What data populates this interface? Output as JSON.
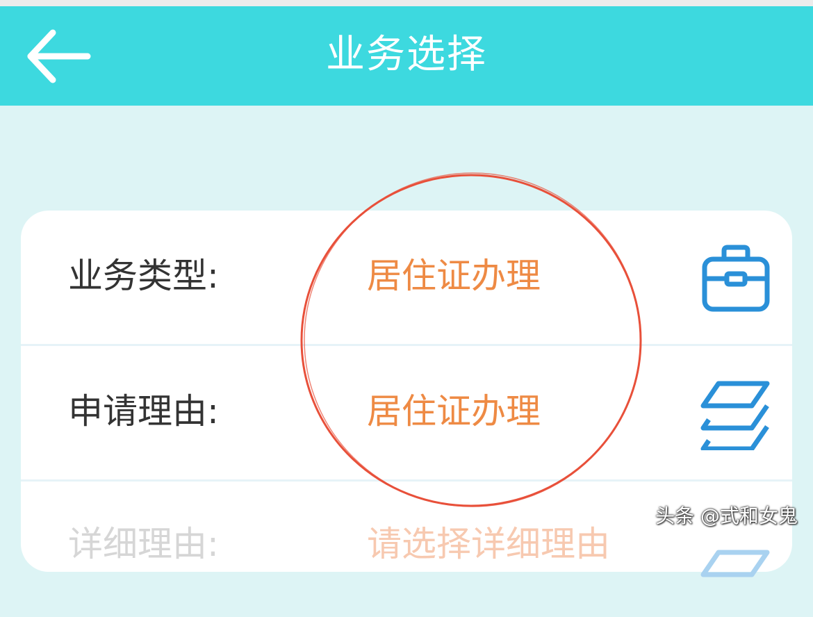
{
  "header": {
    "title": "业务选择",
    "back_icon": "arrow-left-icon",
    "background_color": "#3dd9df"
  },
  "form": {
    "rows": [
      {
        "label": "业务类型:",
        "value": "居住证办理",
        "icon": "briefcase-icon"
      },
      {
        "label": "申请理由:",
        "value": "居住证办理",
        "icon": "layers-icon"
      },
      {
        "label": "详细理由:",
        "value": "请选择详细理由",
        "icon": "layers-icon"
      }
    ],
    "value_color": "#ee8a44",
    "icon_color": "#2a90d8"
  },
  "annotation": {
    "shape": "hand-drawn circle",
    "color": "#e8503a"
  },
  "watermark": {
    "text": "头条 @式和女鬼"
  }
}
